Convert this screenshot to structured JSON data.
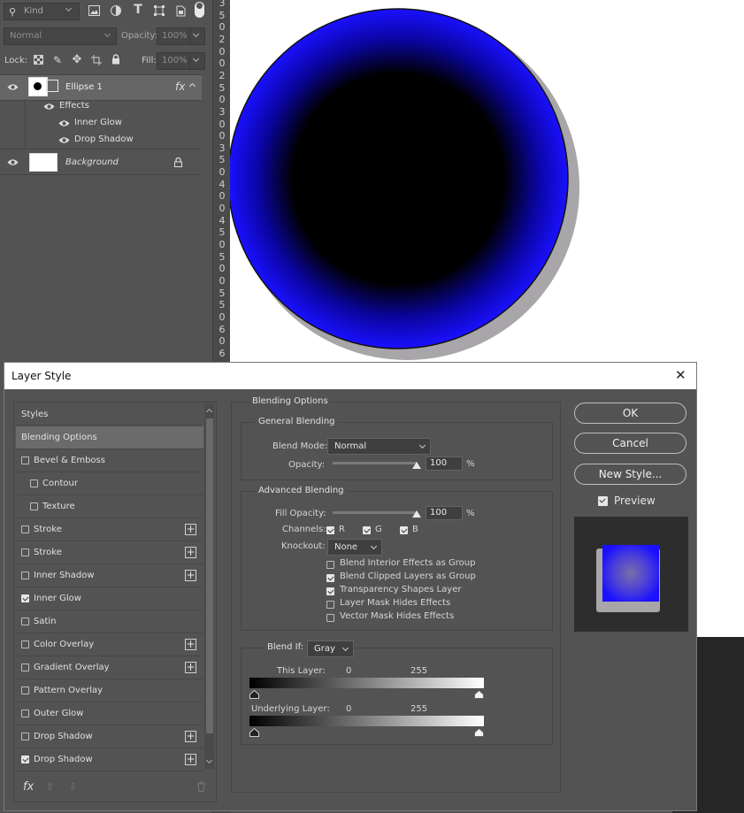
{
  "layers_panel": {
    "filter_placeholder": "Kind",
    "blend_mode": "Normal",
    "opacity_label": "Opacity:",
    "opacity_value": "100%",
    "lock_label": "Lock:",
    "fill_label": "Fill:",
    "fill_value": "100%",
    "layer_name": "Ellipse 1",
    "fx_label": "fx",
    "effects_label": "Effects",
    "effect_1": "Inner Glow",
    "effect_2": "Drop Shadow",
    "background_name": "Background"
  },
  "ruler": {
    "digits": [
      "3",
      "5",
      "0",
      "2",
      "0",
      "0",
      "2",
      "5",
      "0",
      "3",
      "0",
      "0",
      "3",
      "5",
      "0",
      "4",
      "0",
      "0",
      "4",
      "5",
      "0",
      "5",
      "0",
      "0",
      "5",
      "5",
      "0",
      "6",
      "0",
      "6"
    ],
    "bottom_digit": "0"
  },
  "dialog": {
    "title": "Layer Style",
    "close_glyph": "✕",
    "styles_header": "Styles",
    "styles": [
      {
        "label": "Blending Options",
        "checkbox": false,
        "plus": false,
        "selected": true,
        "indent": false
      },
      {
        "label": "Bevel & Emboss",
        "checkbox": true,
        "checked": false,
        "plus": false
      },
      {
        "label": "Contour",
        "checkbox": true,
        "checked": false,
        "plus": false,
        "indent": true
      },
      {
        "label": "Texture",
        "checkbox": true,
        "checked": false,
        "plus": false,
        "indent": true
      },
      {
        "label": "Stroke",
        "checkbox": true,
        "checked": false,
        "plus": true
      },
      {
        "label": "Stroke",
        "checkbox": true,
        "checked": false,
        "plus": true
      },
      {
        "label": "Inner Shadow",
        "checkbox": true,
        "checked": false,
        "plus": true
      },
      {
        "label": "Inner Glow",
        "checkbox": true,
        "checked": true,
        "plus": false
      },
      {
        "label": "Satin",
        "checkbox": true,
        "checked": false,
        "plus": false
      },
      {
        "label": "Color Overlay",
        "checkbox": true,
        "checked": false,
        "plus": true
      },
      {
        "label": "Gradient Overlay",
        "checkbox": true,
        "checked": false,
        "plus": true
      },
      {
        "label": "Pattern Overlay",
        "checkbox": true,
        "checked": false,
        "plus": false
      },
      {
        "label": "Outer Glow",
        "checkbox": true,
        "checked": false,
        "plus": false
      },
      {
        "label": "Drop Shadow",
        "checkbox": true,
        "checked": false,
        "plus": true
      },
      {
        "label": "Drop Shadow",
        "checkbox": true,
        "checked": true,
        "plus": true
      }
    ],
    "fx_button": "fx",
    "blending_options_title": "Blending Options",
    "general_blending": "General Blending",
    "blend_mode_label": "Blend Mode:",
    "blend_mode_value": "Normal",
    "opacity_label": "Opacity:",
    "opacity_value": "100",
    "percent": "%",
    "advanced_blending": "Advanced Blending",
    "fill_opacity_label": "Fill Opacity:",
    "fill_opacity_value": "100",
    "channels_label": "Channels:",
    "channel_r": "R",
    "channel_g": "G",
    "channel_b": "B",
    "knockout_label": "Knockout:",
    "knockout_value": "None",
    "options": [
      {
        "label": "Blend Interior Effects as Group",
        "checked": false
      },
      {
        "label": "Blend Clipped Layers as Group",
        "checked": true
      },
      {
        "label": "Transparency Shapes Layer",
        "checked": true
      },
      {
        "label": "Layer Mask Hides Effects",
        "checked": false
      },
      {
        "label": "Vector Mask Hides Effects",
        "checked": false
      }
    ],
    "blend_if_label": "Blend If:",
    "blend_if_value": "Gray",
    "this_layer_label": "This Layer:",
    "this_layer_min": "0",
    "this_layer_max": "255",
    "underlying_label": "Underlying Layer:",
    "underlying_min": "0",
    "underlying_max": "255",
    "ok": "OK",
    "cancel": "Cancel",
    "new_style": "New Style...",
    "preview_label": "Preview",
    "preview_checked": true
  },
  "colors": {
    "ellipse_fill": "#1a10ff",
    "ellipse_center": "#000000",
    "shadow": "#a8a6a8",
    "panel_bg": "#535353",
    "canvas_bg": "#ffffff"
  }
}
